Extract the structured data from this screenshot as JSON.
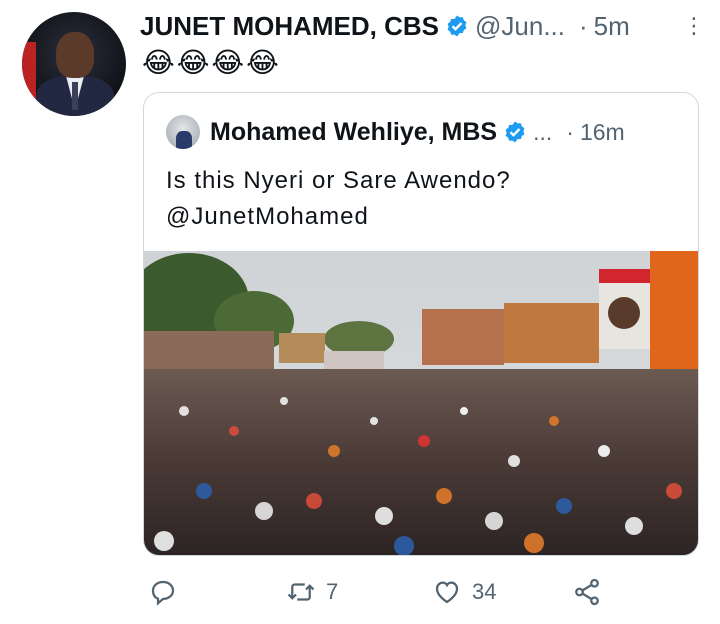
{
  "tweet": {
    "author_name": "JUNET MOHAMED, CBS",
    "handle": "@Jun...",
    "separator": "·",
    "time": "5m",
    "text": "😂😂😂😂"
  },
  "quoted": {
    "author_name": "Mohamed Wehliye, MBS",
    "handle": "...",
    "separator": "·",
    "time": "16m",
    "text_line1": "Is this Nyeri or Sare Awendo?",
    "text_line2": "@JunetMohamed"
  },
  "actions": {
    "reply_count": "",
    "retweet_count": "7",
    "like_count": "34"
  },
  "colors": {
    "verified": "#1d9bf0",
    "secondary_text": "#536471",
    "border": "#cfd9de"
  }
}
